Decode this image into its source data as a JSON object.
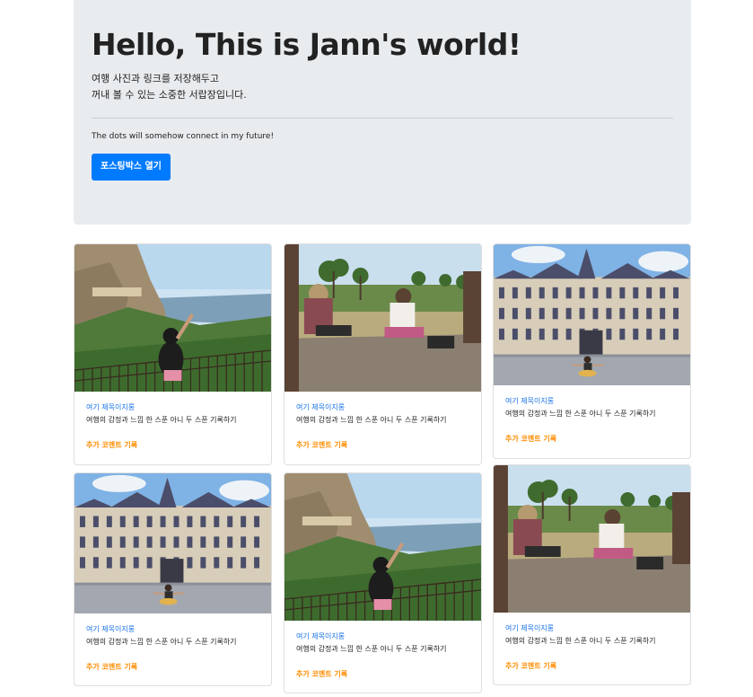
{
  "hero": {
    "title": "Hello, This is Jann's world!",
    "lead_line1": "여행 사진과 링크를 저장해두고",
    "lead_line2": "꺼내 볼 수 있는 소중한 서랍장입니다.",
    "motto": "The dots will somehow connect in my future!",
    "button_label": "포스팅박스 열기"
  },
  "cards": [
    {
      "scene": "mountain",
      "title": "여기 제목이지롱",
      "text": "여행의 감정과 느낌 한 스푼 아니 두 스푼 기록하기",
      "comment_label": "추가 코멘트 기록"
    },
    {
      "scene": "park",
      "title": "여기 제목이지롱",
      "text": "여행의 감정과 느낌 한 스푼 아니 두 스푼 기록하기",
      "comment_label": "추가 코멘트 기록"
    },
    {
      "scene": "palace",
      "title": "여기 제목이지롱",
      "text": "여행의 감정과 느낌 한 스푼 아니 두 스푼 기록하기",
      "comment_label": "추가 코멘트 기록"
    },
    {
      "scene": "palace",
      "title": "여기 제목이지롱",
      "text": "여행의 감정과 느낌 한 스푼 아니 두 스푼 기록하기",
      "comment_label": "추가 코멘트 기록"
    },
    {
      "scene": "mountain",
      "title": "여기 제목이지롱",
      "text": "여행의 감정과 느낌 한 스푼 아니 두 스푼 기록하기",
      "comment_label": "추가 코멘트 기록"
    },
    {
      "scene": "park",
      "title": "여기 제목이지롱",
      "text": "여행의 감정과 느낌 한 스푼 아니 두 스푼 기록하기",
      "comment_label": "추가 코멘트 기록"
    }
  ],
  "colors": {
    "jumbotron_bg": "#e9ecef",
    "primary": "#007bff",
    "card_title": "#1a73e8",
    "comment_link": "#ff8c00"
  }
}
